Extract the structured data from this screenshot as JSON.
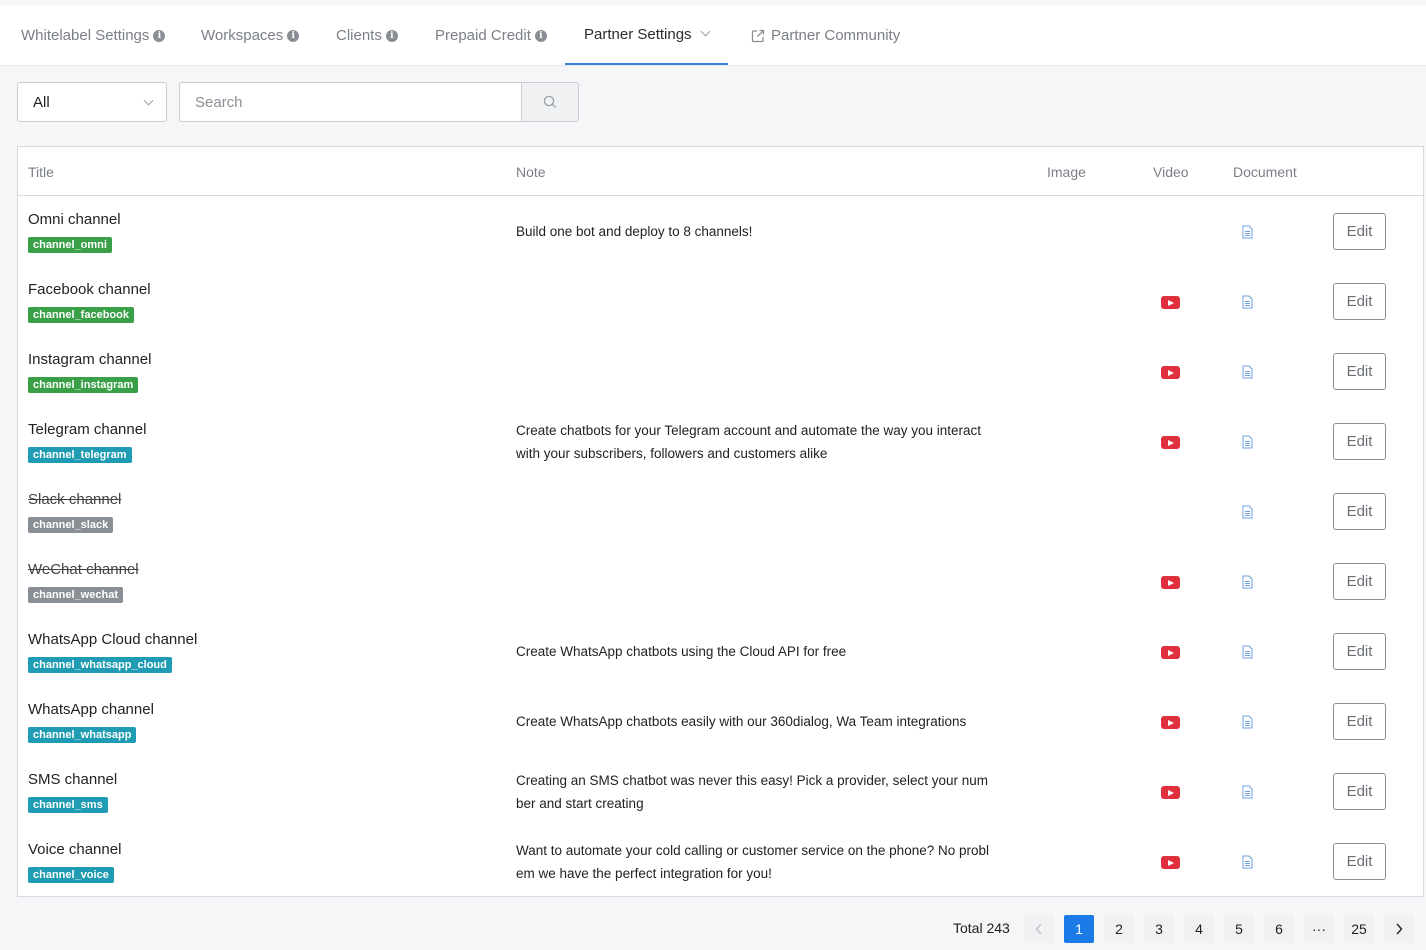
{
  "tabs": [
    {
      "label": "Whitelabel Settings",
      "info": true
    },
    {
      "label": "Workspaces",
      "info": true
    },
    {
      "label": "Clients",
      "info": true
    },
    {
      "label": "Prepaid Credit",
      "info": true
    },
    {
      "label": "Partner Settings",
      "active": true,
      "dropdown": true
    },
    {
      "label": "Partner Community",
      "external": true
    }
  ],
  "filter": {
    "selected": "All"
  },
  "search": {
    "placeholder": "Search"
  },
  "table": {
    "headers": {
      "title": "Title",
      "note": "Note",
      "image": "Image",
      "video": "Video",
      "document": "Document"
    },
    "edit_label": "Edit",
    "rows": [
      {
        "title": "Omni channel",
        "tag": "channel_omni",
        "tag_color": "#3aa047",
        "note": "Build one bot and deploy to 8 channels!",
        "video": false,
        "strike": false
      },
      {
        "title": "Facebook channel",
        "tag": "channel_facebook",
        "tag_color": "#3aa047",
        "note": "",
        "video": true,
        "strike": false
      },
      {
        "title": "Instagram channel",
        "tag": "channel_instagram",
        "tag_color": "#3aa047",
        "note": "",
        "video": true,
        "strike": false
      },
      {
        "title": "Telegram channel",
        "tag": "channel_telegram",
        "tag_color": "#1f9bb3",
        "note": "Create chatbots for your Telegram account and automate the way you interact with your subscribers, followers and customers alike",
        "video": true,
        "strike": false
      },
      {
        "title": "Slack channel",
        "tag": "channel_slack",
        "tag_color": "#8a8f96",
        "note": "",
        "video": false,
        "strike": true
      },
      {
        "title": "WeChat channel",
        "tag": "channel_wechat",
        "tag_color": "#8a8f96",
        "note": "",
        "video": true,
        "strike": true
      },
      {
        "title": "WhatsApp Cloud channel",
        "tag": "channel_whatsapp_cloud",
        "tag_color": "#1f9bb3",
        "note": "Create WhatsApp chatbots using the Cloud API for free",
        "video": true,
        "strike": false
      },
      {
        "title": "WhatsApp channel",
        "tag": "channel_whatsapp",
        "tag_color": "#1f9bb3",
        "note": "Create WhatsApp chatbots easily with our 360dialog, Wa Team integrations",
        "video": true,
        "strike": false
      },
      {
        "title": "SMS channel",
        "tag": "channel_sms",
        "tag_color": "#1f9bb3",
        "note": "Creating an SMS chatbot was never this easy! Pick a provider, select your number and start creating",
        "video": true,
        "strike": false
      },
      {
        "title": "Voice channel",
        "tag": "channel_voice",
        "tag_color": "#1f9bb3",
        "note": "Want to automate your cold calling or customer service on the phone? No problem we have the perfect integration for you!",
        "video": true,
        "strike": false
      }
    ]
  },
  "pagination": {
    "total_label": "Total 243",
    "pages": [
      "1",
      "2",
      "3",
      "4",
      "5",
      "6",
      "···",
      "25"
    ],
    "current": "1"
  },
  "colors": {
    "accent": "#1a7ae6",
    "tab_underline": "#2f83d8",
    "video_icon": "#e0303e",
    "doc_icon": "#6fa0dc"
  }
}
